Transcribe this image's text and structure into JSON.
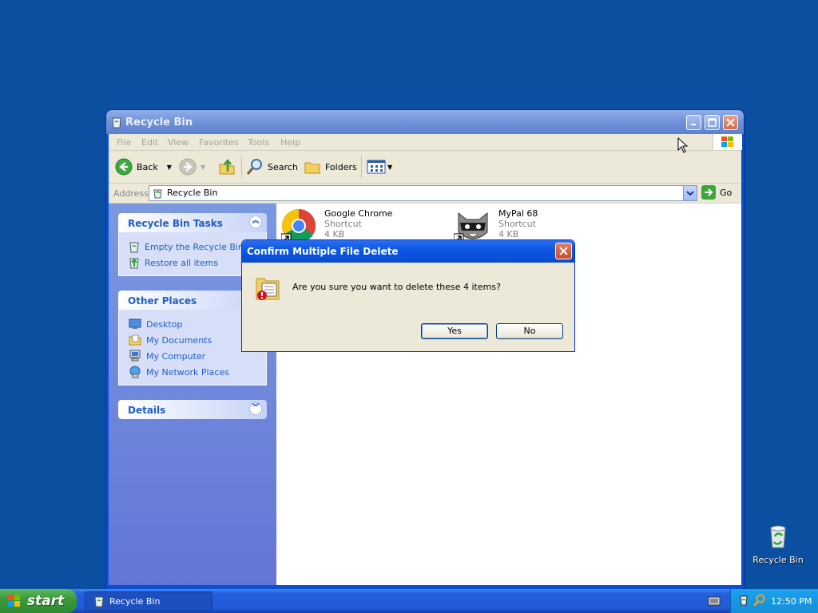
{
  "window": {
    "title": "Recycle Bin",
    "menu": [
      "File",
      "Edit",
      "View",
      "Favorites",
      "Tools",
      "Help"
    ],
    "toolbar": {
      "back": "Back",
      "search": "Search",
      "folders": "Folders"
    },
    "address": {
      "label": "Address",
      "value": "Recycle Bin",
      "go": "Go"
    }
  },
  "tasks": {
    "title": "Recycle Bin Tasks",
    "items": [
      "Empty the Recycle Bin",
      "Restore all items"
    ]
  },
  "other_places": {
    "title": "Other Places",
    "items": [
      "Desktop",
      "My Documents",
      "My Computer",
      "My Network Places"
    ]
  },
  "details": {
    "title": "Details"
  },
  "files": [
    {
      "name": "Google Chrome",
      "type": "Shortcut",
      "size": "4 KB"
    },
    {
      "name": "MyPal 68",
      "type": "Shortcut",
      "size": "4 KB"
    }
  ],
  "dialog": {
    "title": "Confirm Multiple File Delete",
    "message": "Are you sure you want to delete these 4 items?",
    "yes": "Yes",
    "no": "No"
  },
  "desktop": {
    "recycle_bin_label": "Recycle Bin"
  },
  "taskbar": {
    "start": "start",
    "task": "Recycle Bin",
    "clock": "12:50 PM"
  }
}
